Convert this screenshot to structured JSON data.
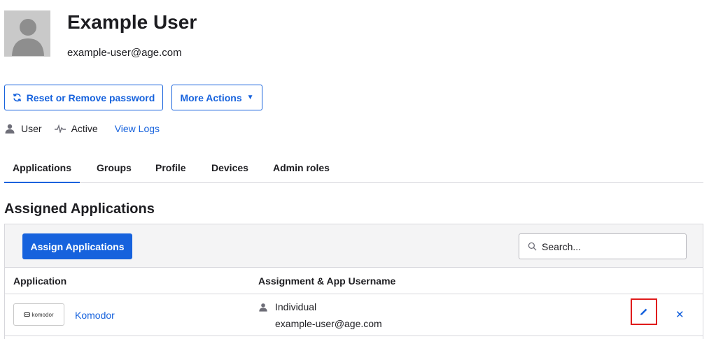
{
  "user": {
    "name": "Example User",
    "email": "example-user@age.com"
  },
  "actions": {
    "reset_label": "Reset or Remove password",
    "more_label": "More Actions"
  },
  "status": {
    "type": "User",
    "state": "Active",
    "logs_link": "View Logs"
  },
  "tabs": [
    {
      "label": "Applications",
      "active": true
    },
    {
      "label": "Groups",
      "active": false
    },
    {
      "label": "Profile",
      "active": false
    },
    {
      "label": "Devices",
      "active": false
    },
    {
      "label": "Admin roles",
      "active": false
    }
  ],
  "section": {
    "title": "Assigned Applications"
  },
  "toolbar": {
    "assign_label": "Assign Applications",
    "search_placeholder": "Search..."
  },
  "table": {
    "columns": [
      "Application",
      "Assignment & App Username"
    ],
    "rows": [
      {
        "logo_text": "komodor",
        "app_name": "Komodor",
        "assignment": "Individual",
        "username": "example-user@age.com"
      }
    ]
  },
  "colors": {
    "accent": "#1662dd",
    "highlight": "#e01b1b"
  }
}
